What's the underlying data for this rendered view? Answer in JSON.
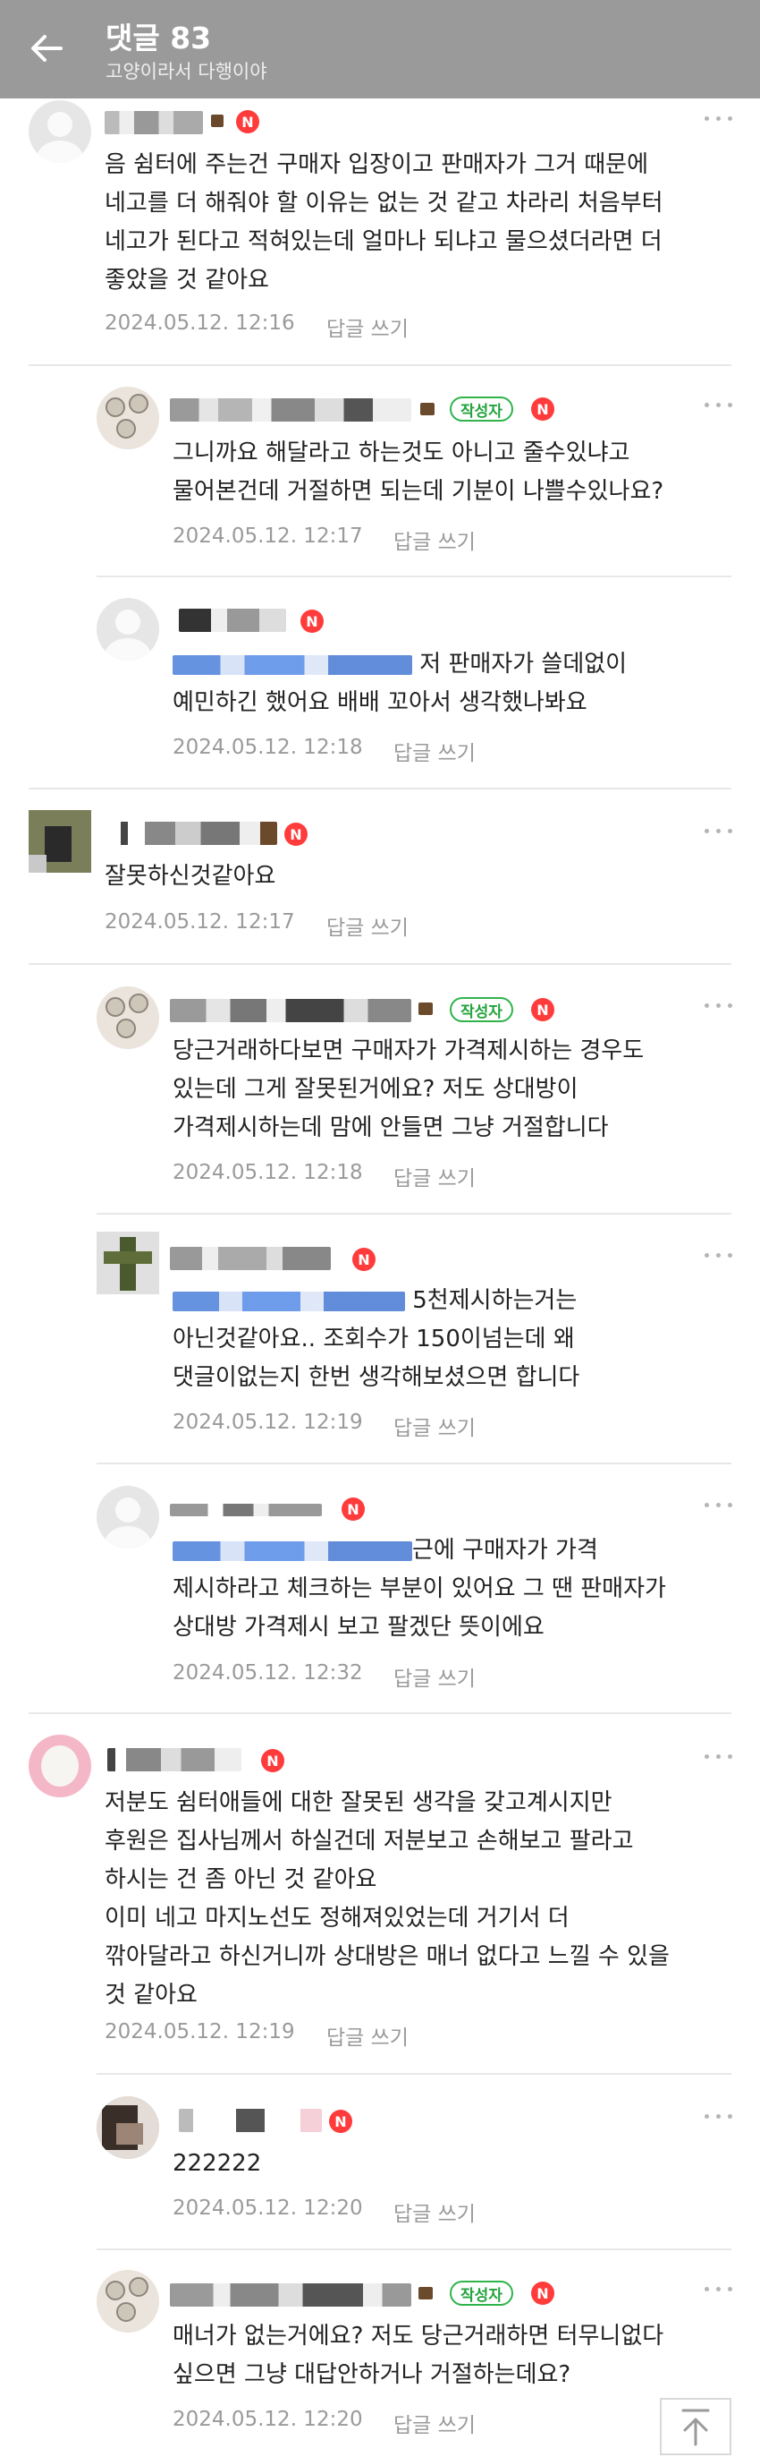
{
  "header": {
    "title": "댓글 83",
    "subtitle": "고양이라서 다행이야"
  },
  "labels": {
    "writer_badge": "작성자",
    "new_badge": "N",
    "reply": "답글 쓰기"
  },
  "comments": [
    {
      "text": "음 쉼터에 주는건 구매자 입장이고 판매자가 그거 때문에\n네고를 더 해줘야 할 이유는 없는 것 같고 차라리 처음부터\n네고가 된다고 적혀있는데 얼마나 되냐고 물으셨더라면 더\n좋았을 것 같아요",
      "time": "2024.05.12. 12:16"
    },
    {
      "text": "그니까요 해달라고 하는것도 아니고 줄수있냐고\n물어본건데 거절하면 되는데 기분이 나쁠수있나요?",
      "time": "2024.05.12. 12:17"
    },
    {
      "text_a": " 저 판매자가 쓸데없이",
      "text_b": "예민하긴 했어요 배배 꼬아서 생각했나봐요",
      "time": "2024.05.12. 12:18"
    },
    {
      "text": "잘못하신것같아요",
      "time": "2024.05.12. 12:17"
    },
    {
      "text": "당근거래하다보면 구매자가 가격제시하는 경우도\n있는데 그게 잘못된거에요? 저도 상대방이\n가격제시하는데 맘에 안들면 그냥 거절합니다",
      "time": "2024.05.12. 12:18"
    },
    {
      "text_a": " 5천제시하는거는",
      "text_b": "아닌것같아요.. 조회수가 150이넘는데 왜\n댓글이없는지 한번 생각해보셨으면 합니다",
      "time": "2024.05.12. 12:19"
    },
    {
      "text_a": "근에 구매자가 가격",
      "text_b": "제시하라고 체크하는 부분이 있어요 그 땐 판매자가\n상대방 가격제시 보고 팔겠단 뜻이에요",
      "time": "2024.05.12. 12:32"
    },
    {
      "text": "저분도 쉼터애들에 대한 잘못된 생각을 갖고계시지만\n후원은 집사님께서 하실건데 저분보고 손해보고 팔라고\n하시는 건 좀 아닌 것 같아요\n이미 네고 마지노선도 정해져있었는데 거기서 더\n깎아달라고 하신거니까 상대방은 매너 없다고 느낄 수 있을\n것 같아요",
      "time": "2024.05.12. 12:19"
    },
    {
      "text": "222222",
      "time": "2024.05.12. 12:20"
    },
    {
      "text": "매너가 없는거에요? 저도 당근거래하면 터무니없다\n싶으면 그냥 대답안하거나 거절하는데요?",
      "time": "2024.05.12. 12:20"
    }
  ]
}
